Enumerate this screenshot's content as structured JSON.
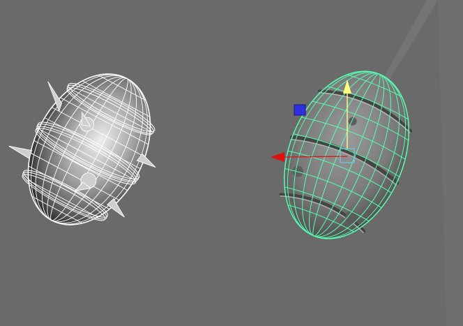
{
  "viewport": {
    "background": "#6a6a6a",
    "objects": [
      {
        "name": "spiked-egg-wireframe",
        "display": "wireframe-on-shaded",
        "selected": false
      },
      {
        "name": "egg-shell-shaded",
        "display": "wireframe-on-shaded",
        "selected": true
      }
    ],
    "manipulator": {
      "tool": "move",
      "x_axis_color": "#e01010",
      "y_axis_color": "#ffff80",
      "center_handle_color": "#6fc8e0",
      "plane_handle_color": "#3030e0"
    },
    "colors": {
      "wire_white": "#ffffff",
      "wire_selected": "#56ffb0"
    }
  }
}
